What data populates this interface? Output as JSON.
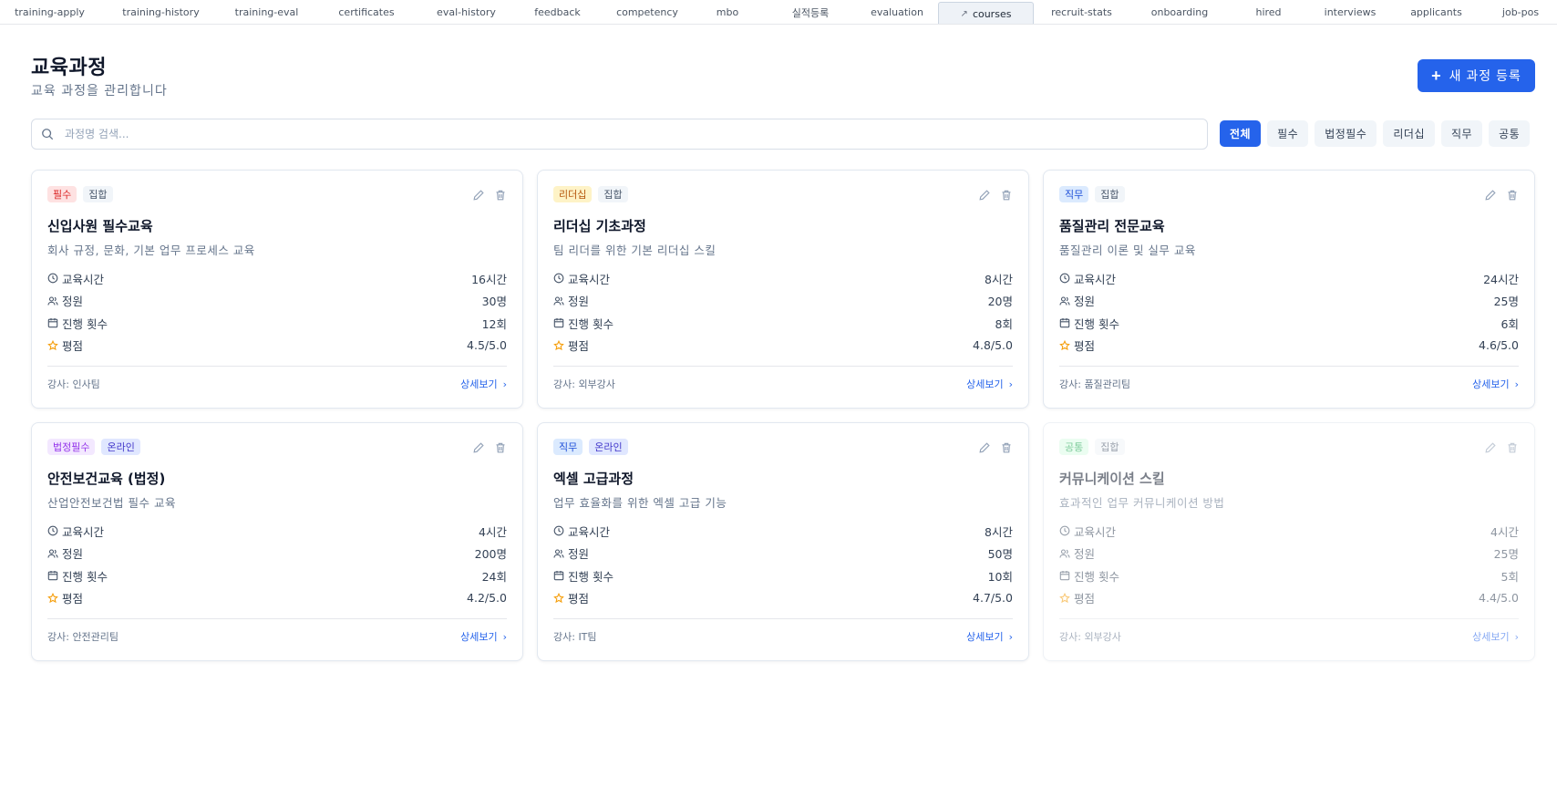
{
  "tabs": [
    {
      "label": "training-apply",
      "w": 109
    },
    {
      "label": "training-history",
      "w": 135
    },
    {
      "label": "training-eval",
      "w": 97
    },
    {
      "label": "certificates",
      "w": 122
    },
    {
      "label": "eval-history",
      "w": 97
    },
    {
      "label": "feedback",
      "w": 103
    },
    {
      "label": "competency",
      "w": 94
    },
    {
      "label": "mbo",
      "w": 82
    },
    {
      "label": "실적등록",
      "w": 100
    },
    {
      "label": "evaluation",
      "w": 90
    },
    {
      "label": "courses",
      "w": 105,
      "active": true
    },
    {
      "label": "recruit-stats",
      "w": 105
    },
    {
      "label": "onboarding",
      "w": 110
    },
    {
      "label": "hired",
      "w": 85
    },
    {
      "label": "interviews",
      "w": 94
    },
    {
      "label": "applicants",
      "w": 95
    },
    {
      "label": "job-pos",
      "w": 90
    }
  ],
  "header": {
    "title": "교육과정",
    "subtitle": "교육 과정을 관리합니다",
    "new_button": "새 과정 등록"
  },
  "search": {
    "placeholder": "과정명 검색..."
  },
  "filters": [
    "전체",
    "필수",
    "법정필수",
    "리더십",
    "직무",
    "공통"
  ],
  "active_filter": "전체",
  "stat_labels": {
    "hours": "교육시간",
    "capacity": "정원",
    "sessions": "진행 횟수",
    "rating": "평점"
  },
  "detail_label": "상세보기",
  "cards": [
    {
      "badges": [
        {
          "text": "필수",
          "color": "red"
        },
        {
          "text": "집합",
          "color": "gray"
        }
      ],
      "title": "신입사원 필수교육",
      "description": "회사 규정, 문화, 기본 업무 프로세스 교육",
      "hours": "16시간",
      "capacity": "30명",
      "sessions": "12회",
      "rating": "4.5/5.0",
      "instructor": "강사: 인사팀",
      "dim": false
    },
    {
      "badges": [
        {
          "text": "리더십",
          "color": "amber"
        },
        {
          "text": "집합",
          "color": "gray"
        }
      ],
      "title": "리더십 기초과정",
      "description": "팀 리더를 위한 기본 리더십 스킬",
      "hours": "8시간",
      "capacity": "20명",
      "sessions": "8회",
      "rating": "4.8/5.0",
      "instructor": "강사: 외부강사",
      "dim": false
    },
    {
      "badges": [
        {
          "text": "직무",
          "color": "blue"
        },
        {
          "text": "집합",
          "color": "gray"
        }
      ],
      "title": "품질관리 전문교육",
      "description": "품질관리 이론 및 실무 교육",
      "hours": "24시간",
      "capacity": "25명",
      "sessions": "6회",
      "rating": "4.6/5.0",
      "instructor": "강사: 품질관리팀",
      "dim": false
    },
    {
      "badges": [
        {
          "text": "법정필수",
          "color": "purple"
        },
        {
          "text": "온라인",
          "color": "indigo"
        }
      ],
      "title": "안전보건교육 (법정)",
      "description": "산업안전보건법 필수 교육",
      "hours": "4시간",
      "capacity": "200명",
      "sessions": "24회",
      "rating": "4.2/5.0",
      "instructor": "강사: 안전관리팀",
      "dim": false
    },
    {
      "badges": [
        {
          "text": "직무",
          "color": "blue"
        },
        {
          "text": "온라인",
          "color": "indigo"
        }
      ],
      "title": "엑셀 고급과정",
      "description": "업무 효율화를 위한 엑셀 고급 기능",
      "hours": "8시간",
      "capacity": "50명",
      "sessions": "10회",
      "rating": "4.7/5.0",
      "instructor": "강사: IT팀",
      "dim": false
    },
    {
      "badges": [
        {
          "text": "공통",
          "color": "green"
        },
        {
          "text": "집합",
          "color": "gray"
        }
      ],
      "title": "커뮤니케이션 스킬",
      "description": "효과적인 업무 커뮤니케이션 방법",
      "hours": "4시간",
      "capacity": "25명",
      "sessions": "5회",
      "rating": "4.4/5.0",
      "instructor": "강사: 외부강사",
      "dim": true
    }
  ],
  "colors": {
    "accent": "#2563eb",
    "star": "#f59e0b"
  }
}
